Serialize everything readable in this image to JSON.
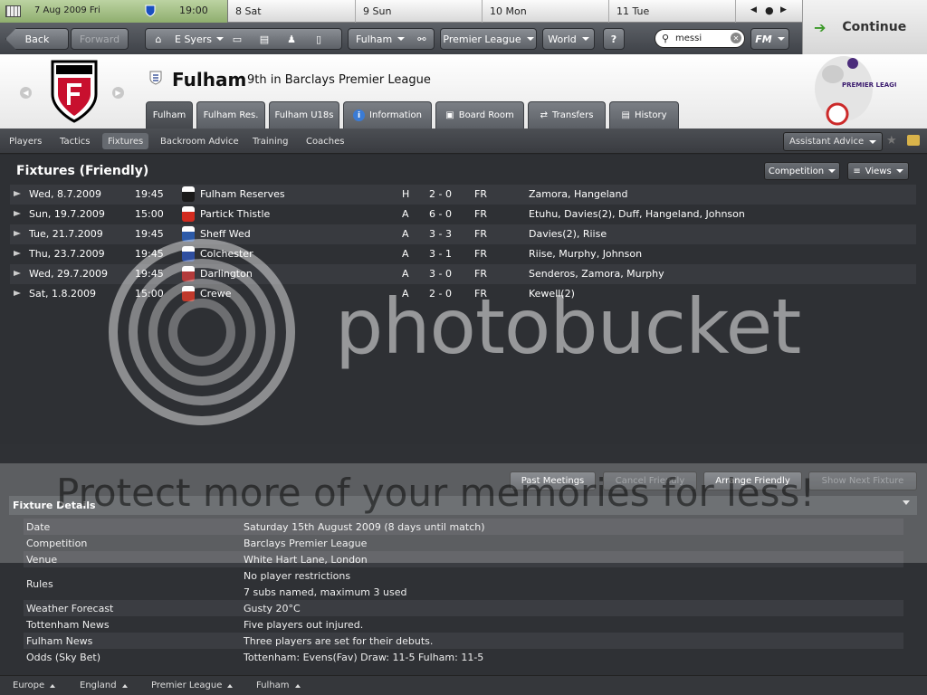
{
  "calendar": {
    "date": "7 Aug 2009  Fri",
    "time": "19:00",
    "days": [
      {
        "num": "8",
        "name": "Sat"
      },
      {
        "num": "9",
        "name": "Sun"
      },
      {
        "num": "10",
        "name": "Mon"
      },
      {
        "num": "11",
        "name": "Tue"
      }
    ]
  },
  "nav": {
    "back": "Back",
    "forward": "Forward",
    "manager": "E Syers",
    "club_menu": "Fulham",
    "league_menu": "Premier League",
    "world_menu": "World",
    "help": "?",
    "search_value": "messi",
    "fm_menu": "FM",
    "continue": "Continue"
  },
  "header": {
    "club": "Fulham",
    "subtitle": "9th in Barclays Premier League",
    "pl_logo_text": "PREMIER LEAGUE"
  },
  "tabs": [
    "Fulham",
    "Fulham Res.",
    "Fulham U18s",
    "Information",
    "Board Room",
    "Transfers",
    "History"
  ],
  "subnav": {
    "items": [
      "Players",
      "Tactics",
      "Fixtures",
      "Backroom Advice",
      "Training",
      "Coaches"
    ],
    "assistant": "Assistant Advice"
  },
  "fixtures": {
    "title": "Fixtures (Friendly)",
    "competition_btn": "Competition",
    "views_btn": "Views",
    "rows": [
      {
        "date": "Wed, 8.7.2009",
        "time": "19:45",
        "opponent": "Fulham Reserves",
        "venue": "H",
        "score": "2 - 0",
        "comp": "FR",
        "scorers": "Zamora, Hangeland",
        "badge_color": "#1a1a1a"
      },
      {
        "date": "Sun, 19.7.2009",
        "time": "15:00",
        "opponent": "Partick Thistle",
        "venue": "A",
        "score": "6 - 0",
        "comp": "FR",
        "scorers": "Etuhu, Davies(2), Duff, Hangeland, Johnson",
        "badge_color": "#d22b1f"
      },
      {
        "date": "Tue, 21.7.2009",
        "time": "19:45",
        "opponent": "Sheff Wed",
        "venue": "A",
        "score": "3 - 3",
        "comp": "FR",
        "scorers": "Davies(2), Riise",
        "badge_color": "#2d5aa8"
      },
      {
        "date": "Thu, 23.7.2009",
        "time": "19:45",
        "opponent": "Colchester",
        "venue": "A",
        "score": "3 - 1",
        "comp": "FR",
        "scorers": "Riise, Murphy, Johnson",
        "badge_color": "#2f4fa0"
      },
      {
        "date": "Wed, 29.7.2009",
        "time": "19:45",
        "opponent": "Darlington",
        "venue": "A",
        "score": "3 - 0",
        "comp": "FR",
        "scorers": "Senderos, Zamora, Murphy",
        "badge_color": "#b33b3b"
      },
      {
        "date": "Sat, 1.8.2009",
        "time": "15:00",
        "opponent": "Crewe",
        "venue": "A",
        "score": "2 - 0",
        "comp": "FR",
        "scorers": "Kewell(2)",
        "badge_color": "#c0392b"
      }
    ]
  },
  "actions": {
    "past_meetings": "Past Meetings",
    "cancel_friendly": "Cancel Friendly",
    "arrange_friendly": "Arrange Friendly",
    "show_next": "Show Next Fixture"
  },
  "details": {
    "title": "Fixture Details",
    "rows": [
      {
        "label": "Date",
        "value": "Saturday 15th August 2009 (8 days until match)"
      },
      {
        "label": "Competition",
        "value": "Barclays Premier League"
      },
      {
        "label": "Venue",
        "value": "White Hart Lane, London"
      },
      {
        "label": "Rules",
        "value": "No player restrictions",
        "value2": "7 subs named, maximum 3 used"
      },
      {
        "label": "Weather Forecast",
        "value": "Gusty 20°C"
      },
      {
        "label": "Tottenham News",
        "value": "Five players out injured."
      },
      {
        "label": "Fulham News",
        "value": "Three players are set for their debuts."
      },
      {
        "label": "Odds (Sky Bet)",
        "value": "Tottenham: Evens(Fav)  Draw: 11-5  Fulham: 11-5"
      }
    ]
  },
  "breadcrumbs": [
    "Europe",
    "England",
    "Premier League",
    "Fulham"
  ],
  "watermark": {
    "brand": "photobucket",
    "slogan": "Protect more of your memories for less!"
  }
}
